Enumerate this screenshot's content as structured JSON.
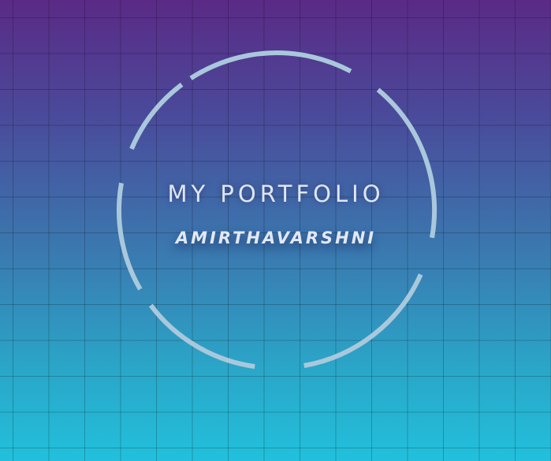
{
  "hero": {
    "title": "MY PORTFOLIO",
    "name": "AMIRTHAVARSHNI"
  },
  "colors": {
    "gradient_top": "#5a2a86",
    "gradient_bottom": "#22c0dc",
    "ring": "#a9c8dc",
    "text": "#dfe6f2"
  }
}
